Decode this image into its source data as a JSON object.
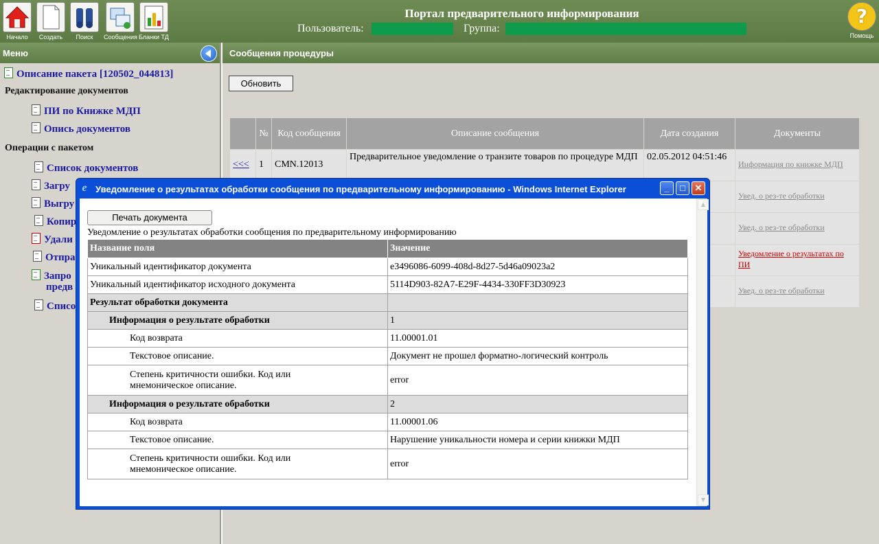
{
  "header": {
    "title": "Портал предварительного информирования",
    "user_label": "Пользователь:",
    "group_label": "Группа:",
    "toolbar": [
      {
        "label": "Начало",
        "icon": "home-icon"
      },
      {
        "label": "Создать",
        "icon": "new-document-icon"
      },
      {
        "label": "Поиск",
        "icon": "binoculars-icon"
      },
      {
        "label": "Сообщения",
        "icon": "messages-icon"
      },
      {
        "label": "Бланки ТД",
        "icon": "chart-icon"
      }
    ],
    "help_label": "Помощь",
    "colors": {
      "bar": "#5c7a43",
      "field": "#0f9b4c"
    }
  },
  "sidebar": {
    "title": "Меню",
    "package": "Описание пакета [120502_044813]",
    "section_edit": "Редактирование документов",
    "edit_items": [
      "ПИ по Книжке МДП",
      "Опись документов"
    ],
    "section_ops": "Операции с пакетом",
    "op_items": [
      "Список документов",
      "Загру",
      "Выгру",
      "Копир",
      "Удали",
      "Отпра",
      "Запро",
      "предв",
      "Списо"
    ]
  },
  "main": {
    "title": "Сообщения процедуры",
    "refresh": "Обновить",
    "columns": {
      "num": "№",
      "code": "Код сообщения",
      "desc": "Описание сообщения",
      "date": "Дата создания",
      "docs": "Документы"
    },
    "row": {
      "nav": "<<<",
      "num": "1",
      "code": "CMN.12013",
      "desc": "Предварительное уведомление о транзите товаров по процедуре МДП",
      "date": "02.05.2012 04:51:46",
      "doc": "Информация по книжке МДП"
    },
    "doc_links": [
      "Увед. о рез-те обработки",
      "Увед. о рез-те обработки",
      "Уведомление о результатах по ПИ",
      "Увед. о рез-те обработки"
    ]
  },
  "popup": {
    "title": "Уведомление о результатах обработки сообщения по предварительному информированию - Windows Internet Explorer",
    "print": "Печать документа",
    "caption": "Уведомление о результатах обработки сообщения по предварительному информированию",
    "col_field": "Название поля",
    "col_value": "Значение",
    "rows": {
      "uid_label": "Уникальный идентификатор документа",
      "uid_value": "e3496086-6099-408d-8d27-5d46a09023a2",
      "src_label": "Уникальный идентификатор исходного документа",
      "src_value": "5114D903-82A7-E29F-4434-330FF3D30923",
      "result_label": "Результат обработки документа",
      "info_label": "Информация о результате обработки",
      "code_label": "Код возврата",
      "text_label": "Текстовое описание.",
      "sev_label": "Степень критичности ошибки. Код или мнемоническое описание."
    },
    "results": [
      {
        "n": "1",
        "code": "11.00001.01",
        "text": "Документ не прошел форматно-логический контроль",
        "sev": "error"
      },
      {
        "n": "2",
        "code": "11.00001.06",
        "text": "Нарушение уникальности номера и серии книжки МДП",
        "sev": "error"
      }
    ]
  }
}
